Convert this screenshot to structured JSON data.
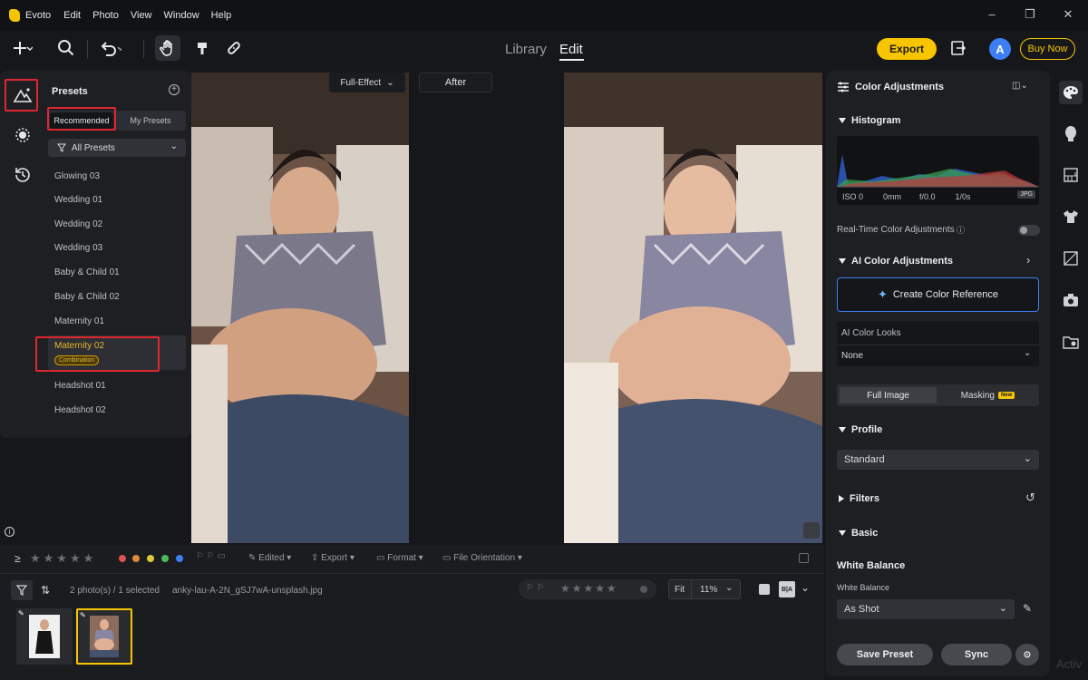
{
  "app": {
    "name": "Evoto",
    "menu": [
      "Edit",
      "Photo",
      "View",
      "Window",
      "Help"
    ]
  },
  "toolbar": {
    "mode_library": "Library",
    "mode_edit": "Edit",
    "export_label": "Export",
    "avatar_letter": "A",
    "buy_now_label": "Buy Now",
    "colors": {
      "accent": "#f7c600",
      "avatar": "#3d7ef2",
      "highlight_box": "#e0262e"
    }
  },
  "presets": {
    "title": "Presets",
    "tabs": [
      "Recommended",
      "My Presets"
    ],
    "filter_value": "All Presets",
    "items": [
      "Glowing 03",
      "Wedding 01",
      "Wedding 02",
      "Wedding 03",
      "Baby & Child 01",
      "Baby & Child 02",
      "Maternity 01",
      "Maternity 02",
      "Headshot 01",
      "Headshot 02"
    ],
    "selected_badge": "Combination"
  },
  "canvas": {
    "compare_mode": "Full-Effect",
    "after_label": "After"
  },
  "color_panel": {
    "title": "Color Adjustments",
    "histogram_title": "Histogram",
    "histogram_meta": [
      "ISO 0",
      "0mm",
      "f/0.0",
      "1/0s"
    ],
    "histogram_format": "JPG",
    "realtime_label": "Real-Time Color Adjustments",
    "ai_color_title": "AI Color Adjustments",
    "create_ref_label": "Create Color Reference",
    "ai_looks_label": "AI Color Looks",
    "ai_looks_value": "None",
    "full_image_label": "Full Image",
    "masking_label": "Masking",
    "new_badge": "New",
    "profile_title": "Profile",
    "profile_value": "Standard",
    "filters_title": "Filters",
    "basic_title": "Basic",
    "white_balance_heading": "White Balance",
    "white_balance_label": "White Balance",
    "white_balance_value": "As Shot",
    "save_preset_label": "Save Preset",
    "sync_label": "Sync"
  },
  "filmstrip": {
    "edited_label": "Edited",
    "export_label": "Export",
    "format_label": "Format",
    "orientation_label": "File Orientation",
    "count_text": "2 photo(s) / 1 selected",
    "filename": "anky-lau-A-2N_gSJ7wA-unsplash.jpg",
    "fit_label": "Fit",
    "zoom_value": "11%",
    "ba_label": "B|A",
    "rating_stars": "★★★★★",
    "color_labels": [
      "#e05252",
      "#e08a3c",
      "#e0c93c",
      "#4dbb5a",
      "#3d7ef2"
    ]
  },
  "os": {
    "watermark": "Activ"
  }
}
